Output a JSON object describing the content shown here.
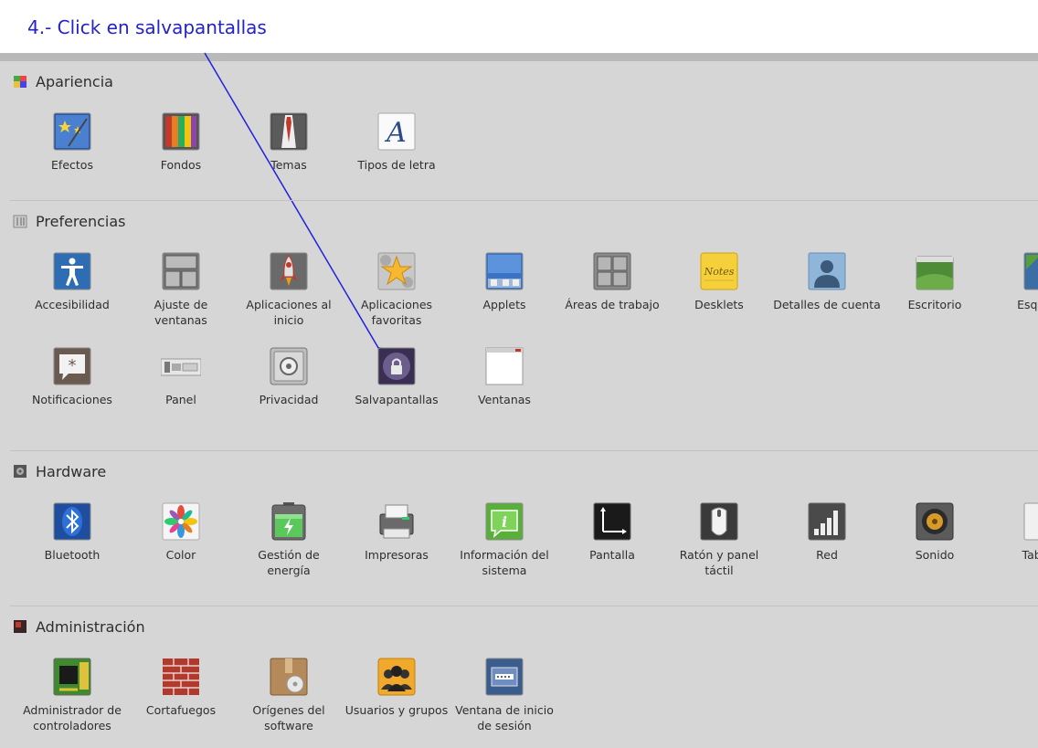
{
  "annotation": {
    "text": "4.- Click en salvapantallas",
    "color": "#2323c8"
  },
  "sections": {
    "apariencia": {
      "title": "Apariencia",
      "items": [
        "Efectos",
        "Fondos",
        "Temas",
        "Tipos de letra"
      ]
    },
    "preferencias": {
      "title": "Preferencias",
      "items": [
        "Accesibilidad",
        "Ajuste de ventanas",
        "Aplicaciones al inicio",
        "Aplicaciones favoritas",
        "Applets",
        "Áreas de trabajo",
        "Desklets",
        "Detalles de cuenta",
        "Escritorio",
        "Esquinas",
        "Notificaciones",
        "Panel",
        "Privacidad",
        "Salvapantallas",
        "Ventanas"
      ]
    },
    "hardware": {
      "title": "Hardware",
      "items": [
        "Bluetooth",
        "Color",
        "Gestión de energía",
        "Impresoras",
        "Información del sistema",
        "Pantalla",
        "Ratón y panel táctil",
        "Red",
        "Sonido",
        "Tableta"
      ]
    },
    "administracion": {
      "title": "Administración",
      "items": [
        "Administrador de controladores",
        "Cortafuegos",
        "Orígenes del software",
        "Usuarios y grupos",
        "Ventana de inicio de sesión"
      ]
    }
  },
  "icons": {
    "apariencia": [
      "effects-icon",
      "wallpaper-icon",
      "themes-icon",
      "fonts-icon"
    ],
    "preferencias": [
      "accessibility-icon",
      "window-tiling-icon",
      "startup-rocket-icon",
      "favorites-star-icon",
      "applets-icon",
      "workspaces-icon",
      "desklets-note-icon",
      "account-user-icon",
      "desktop-icon",
      "hot-corners-icon",
      "notifications-icon",
      "panel-icon",
      "privacy-safe-icon",
      "screensaver-lock-icon",
      "windows-icon"
    ],
    "hardware": [
      "bluetooth-icon",
      "color-icon",
      "power-battery-icon",
      "printer-icon",
      "system-info-icon",
      "display-icon",
      "mouse-icon",
      "network-icon",
      "sound-speaker-icon",
      "tablet-icon"
    ],
    "administracion": [
      "driver-chip-icon",
      "firewall-brick-icon",
      "software-sources-icon",
      "users-groups-icon",
      "login-window-icon"
    ]
  }
}
